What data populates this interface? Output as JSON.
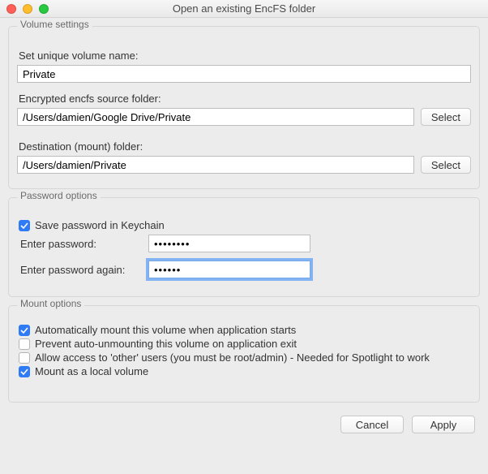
{
  "window": {
    "title": "Open an existing EncFS folder"
  },
  "volume": {
    "group_label": "Volume settings",
    "name_label": "Set unique volume name:",
    "name_value": "Private",
    "source_label": "Encrypted encfs source folder:",
    "source_value": "/Users/damien/Google Drive/Private",
    "dest_label": "Destination (mount) folder:",
    "dest_value": "/Users/damien/Private",
    "select_label": "Select"
  },
  "password": {
    "group_label": "Password options",
    "save_keychain_label": "Save password in Keychain",
    "save_keychain_checked": true,
    "enter_label": "Enter password:",
    "enter_value": "••••••••",
    "again_label": "Enter password again:",
    "again_value": "••••••"
  },
  "mount": {
    "group_label": "Mount options",
    "auto_mount_label": "Automatically mount this volume when application starts",
    "auto_mount_checked": true,
    "prevent_unmount_label": "Prevent auto-unmounting this volume on application exit",
    "prevent_unmount_checked": false,
    "allow_other_label": "Allow access to 'other' users (you must be root/admin) - Needed for Spotlight to work",
    "allow_other_checked": false,
    "local_volume_label": "Mount as a local volume",
    "local_volume_checked": true
  },
  "footer": {
    "cancel": "Cancel",
    "apply": "Apply"
  }
}
